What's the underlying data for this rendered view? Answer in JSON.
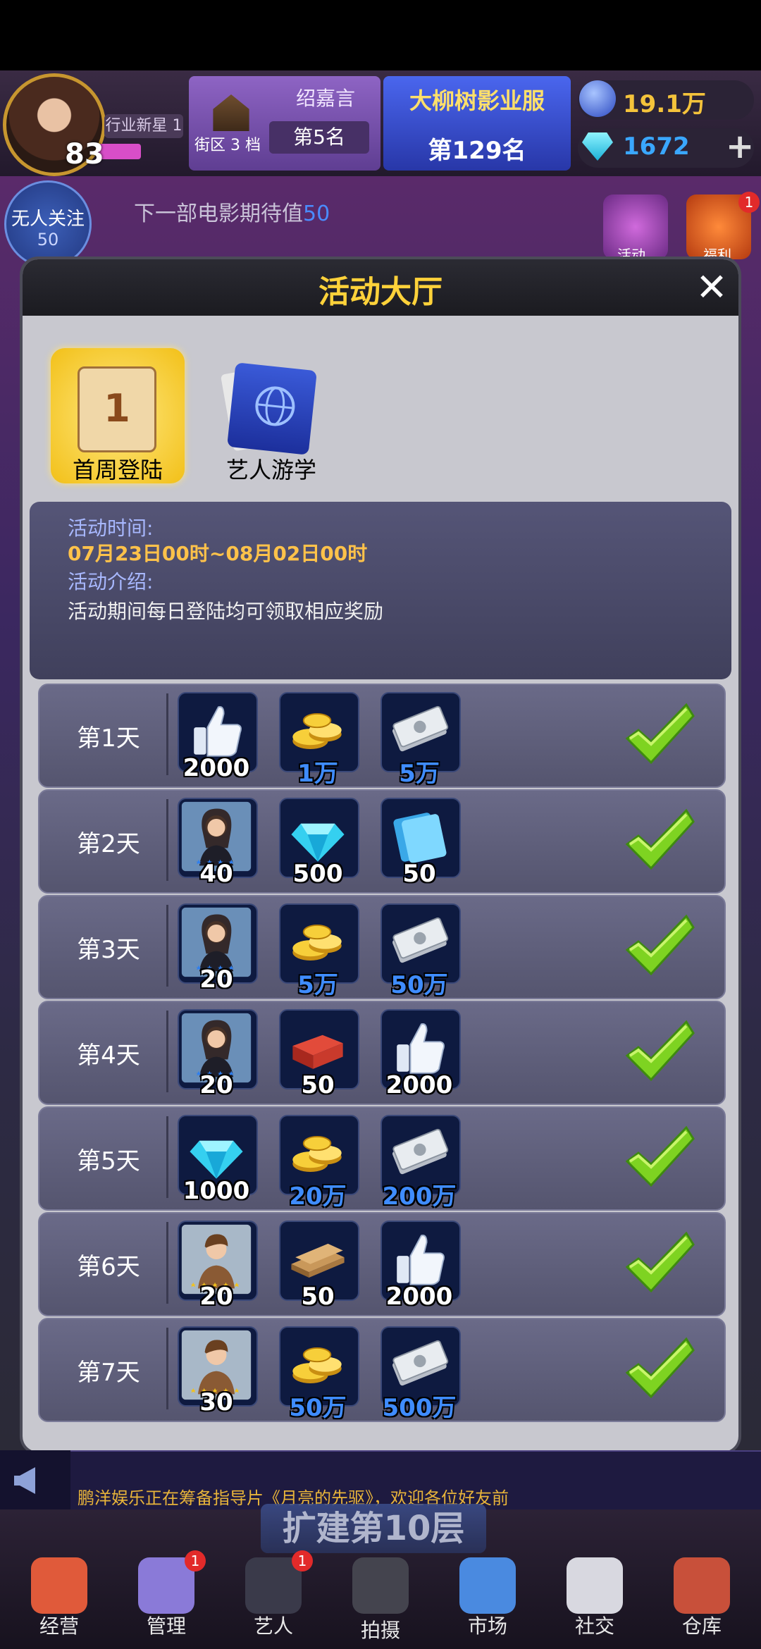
{
  "hud": {
    "level": "83",
    "title_badge": "行业新星 1",
    "player_name": "绍嘉言",
    "street": "街区 3 档",
    "street_rank": "第5名",
    "company": "大柳树影业服",
    "company_rank": "第129名",
    "gold": "19.1万",
    "diamond": "1672",
    "add": "+"
  },
  "scene": {
    "follow_title": "无人关注",
    "follow_value": "50",
    "movie_msg": "下一部电影期待值",
    "movie_value": "50",
    "activity_label": "活动",
    "welfare_label": "福利",
    "welfare_badge": "1"
  },
  "modal": {
    "title": "活动大厅",
    "close": "✕",
    "tabs": [
      {
        "label": "首周登陆",
        "icon": "calendar-icon",
        "active": true,
        "number": "1"
      },
      {
        "label": "艺人游学",
        "icon": "passport-icon",
        "active": false
      }
    ],
    "info": {
      "time_label": "活动时间:",
      "time_value": "07月23日00时~08月02日00时",
      "intro_label": "活动介绍:",
      "intro_value": "活动期间每日登陆均可领取相应奖励"
    },
    "days": [
      {
        "label": "第1天",
        "rewards": [
          {
            "icon": "thumbs-up-icon",
            "qty": "2000",
            "blue": false
          },
          {
            "icon": "gold-coins-icon",
            "qty": "1万",
            "blue": true
          },
          {
            "icon": "cash-icon",
            "qty": "5万",
            "blue": true
          }
        ],
        "claimed": true
      },
      {
        "label": "第2天",
        "rewards": [
          {
            "icon": "actress-card-icon",
            "qty": "40",
            "blue": false
          },
          {
            "icon": "diamond-icon",
            "qty": "500",
            "blue": false
          },
          {
            "icon": "film-card-icon",
            "qty": "50",
            "blue": false
          }
        ],
        "claimed": true
      },
      {
        "label": "第3天",
        "rewards": [
          {
            "icon": "actress-card-icon",
            "qty": "20",
            "blue": false
          },
          {
            "icon": "gold-coins-icon",
            "qty": "5万",
            "blue": true
          },
          {
            "icon": "cash-icon",
            "qty": "50万",
            "blue": true
          }
        ],
        "claimed": true
      },
      {
        "label": "第4天",
        "rewards": [
          {
            "icon": "actress-card-icon",
            "qty": "20",
            "blue": false
          },
          {
            "icon": "bricks-icon",
            "qty": "50",
            "blue": false
          },
          {
            "icon": "thumbs-up-icon",
            "qty": "2000",
            "blue": false
          }
        ],
        "claimed": true
      },
      {
        "label": "第5天",
        "rewards": [
          {
            "icon": "diamond-icon",
            "qty": "1000",
            "blue": false
          },
          {
            "icon": "gold-coins-icon",
            "qty": "20万",
            "blue": true
          },
          {
            "icon": "cash-icon",
            "qty": "200万",
            "blue": true
          }
        ],
        "claimed": true
      },
      {
        "label": "第6天",
        "rewards": [
          {
            "icon": "actor-card-icon",
            "qty": "20",
            "blue": false
          },
          {
            "icon": "planks-icon",
            "qty": "50",
            "blue": false
          },
          {
            "icon": "thumbs-up-icon",
            "qty": "2000",
            "blue": false
          }
        ],
        "claimed": true
      },
      {
        "label": "第7天",
        "rewards": [
          {
            "icon": "actor-card-icon",
            "qty": "30",
            "blue": false
          },
          {
            "icon": "gold-coins-icon",
            "qty": "50万",
            "blue": true
          },
          {
            "icon": "cash-icon",
            "qty": "500万",
            "blue": true
          }
        ],
        "claimed": true
      }
    ]
  },
  "ticker": {
    "text": "鹏洋娱乐正在筹备指导片《月亮的先驱》，欢迎各位好友前"
  },
  "expand_label": "扩建第10层",
  "nav": [
    {
      "label": "经营",
      "icon": "popcorn-icon",
      "badge": ""
    },
    {
      "label": "管理",
      "icon": "manage-icon",
      "badge": "1"
    },
    {
      "label": "艺人",
      "icon": "artist-icon",
      "badge": "1"
    },
    {
      "label": "拍摄",
      "icon": "camera-icon",
      "badge": ""
    },
    {
      "label": "市场",
      "icon": "market-icon",
      "badge": ""
    },
    {
      "label": "社交",
      "icon": "coffee-icon",
      "badge": ""
    },
    {
      "label": "仓库",
      "icon": "warehouse-icon",
      "badge": ""
    }
  ],
  "colors": {
    "accent_gold": "#ffd23a",
    "check_green": "#7ed321",
    "blue_qty": "#3f8cff"
  }
}
